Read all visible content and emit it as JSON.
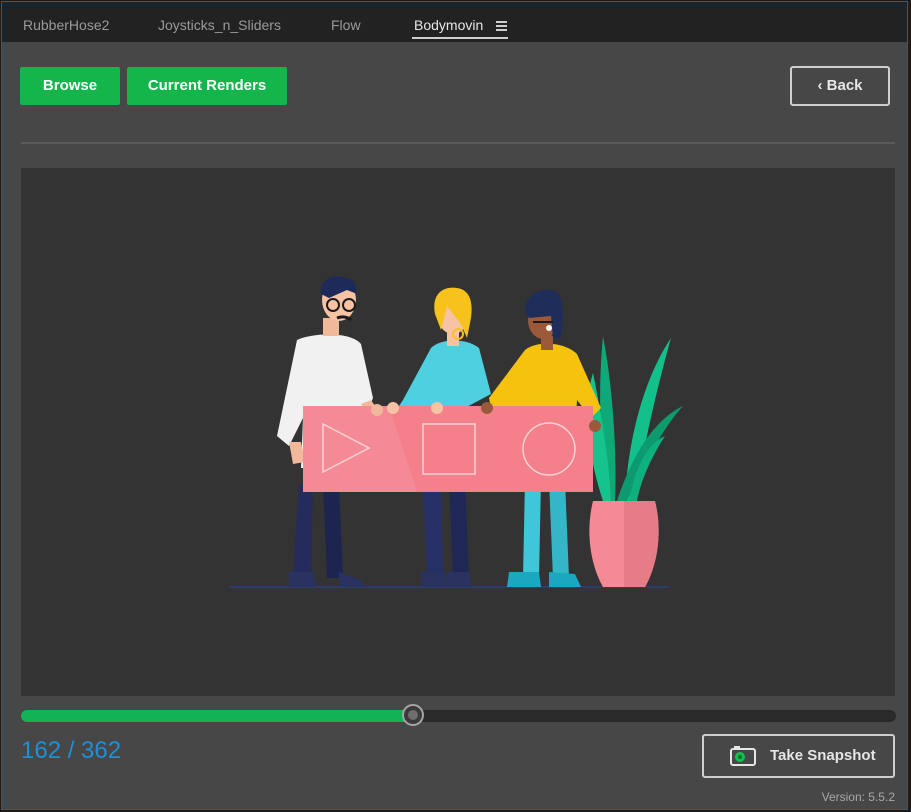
{
  "tabs": [
    {
      "label": "RubberHose2"
    },
    {
      "label": "Joysticks_n_Sliders"
    },
    {
      "label": "Flow"
    },
    {
      "label": "Bodymovin",
      "active": true
    }
  ],
  "toolbar": {
    "browse_label": "Browse",
    "current_renders_label": "Current Renders",
    "back_label": "‹ Back"
  },
  "preview": {
    "illustration": "people-holding-media-banner"
  },
  "timeline": {
    "current_frame": 162,
    "total_frames": 362,
    "counter_text": "162 / 362"
  },
  "snapshot": {
    "label": "Take Snapshot",
    "icon": "camera-icon"
  },
  "footer": {
    "version_text": "Version: 5.5.2"
  },
  "colors": {
    "accent_green": "#12b64b",
    "counter_blue": "#1e90d6",
    "panel_bg": "#474747",
    "preview_bg": "#333333",
    "banner_pink": "#f4808c"
  }
}
